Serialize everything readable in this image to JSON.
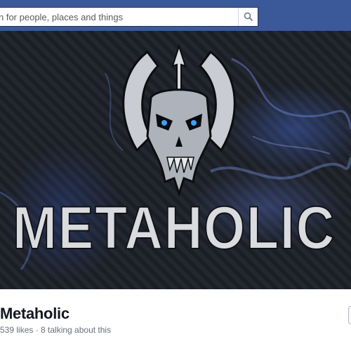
{
  "search": {
    "placeholder": "n for people, places and things",
    "button_icon": "search-icon"
  },
  "cover": {
    "logo_icon": "skull-trident-logo-icon",
    "title_text": "METAHOLIC"
  },
  "page": {
    "name": "Metaholic",
    "stats": "539 likes · 8 talking about this"
  },
  "colors": {
    "topbar": "#3b5998",
    "name": "#141823",
    "stats": "#6a6f7a",
    "cover_smoke": "#4a6ad0"
  }
}
